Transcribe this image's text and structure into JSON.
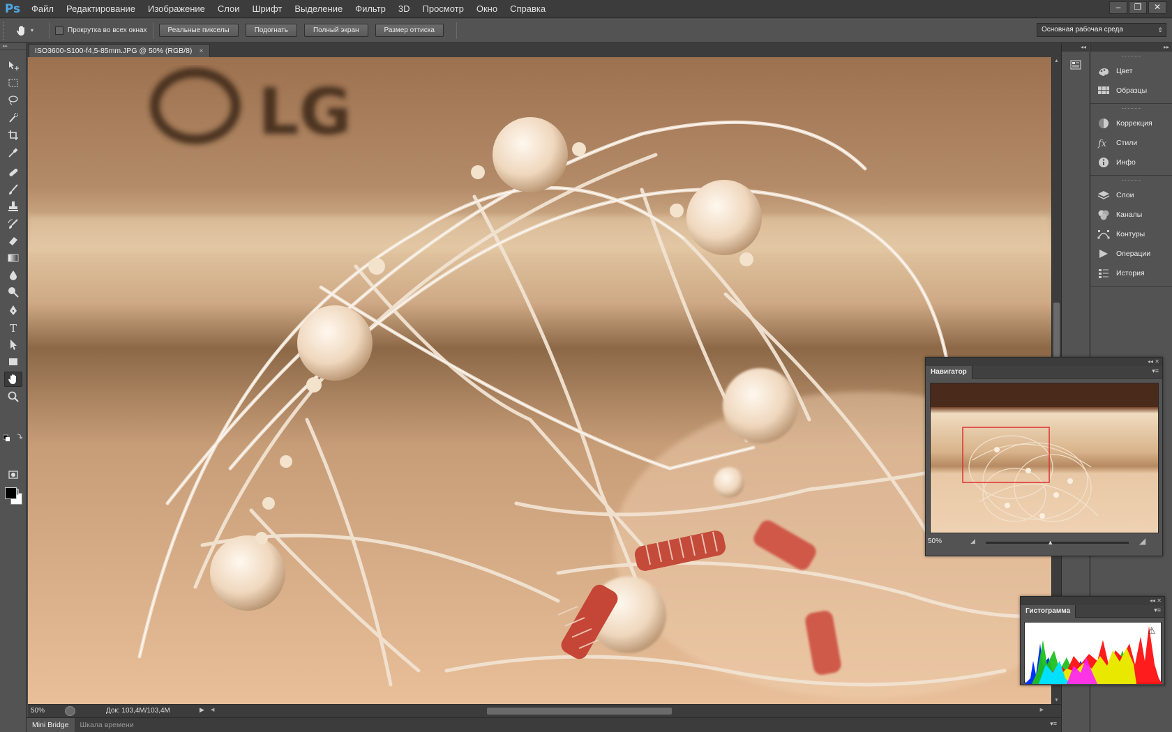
{
  "app": {
    "logo": "Ps"
  },
  "menu": [
    "Файл",
    "Редактирование",
    "Изображение",
    "Слои",
    "Шрифт",
    "Выделение",
    "Фильтр",
    "3D",
    "Просмотр",
    "Окно",
    "Справка"
  ],
  "window_buttons": {
    "minimize": "–",
    "restore": "❐",
    "close": "✕"
  },
  "options": {
    "scroll_all_label": "Прокрутка во всех окнах",
    "scroll_all_checked": false,
    "buttons": [
      "Реальные пикселы",
      "Подогнать",
      "Полный экран",
      "Размер оттиска"
    ],
    "workspace": "Основная рабочая среда"
  },
  "document": {
    "tab_title": "ISO3600-S100-f4,5-85mm.JPG @ 50% (RGB/8)",
    "tab_close": "×",
    "canvas_logo_text": "LG",
    "zoom": "50%",
    "doc_info": "Док: 103,4M/103,4M"
  },
  "bottom_tabs": [
    "Mini Bridge",
    "Шкала времени"
  ],
  "panels": {
    "col1_collapse": "◂◂",
    "col2_collapse": "▸▸",
    "groups": [
      [
        {
          "label": "Цвет",
          "icon": "color-icon"
        },
        {
          "label": "Образцы",
          "icon": "swatches-icon"
        }
      ],
      [
        {
          "label": "Коррекция",
          "icon": "adjustments-icon"
        },
        {
          "label": "Стили",
          "icon": "styles-icon"
        },
        {
          "label": "Инфо",
          "icon": "info-icon"
        }
      ],
      [
        {
          "label": "Слои",
          "icon": "layers-icon"
        },
        {
          "label": "Каналы",
          "icon": "channels-icon"
        },
        {
          "label": "Контуры",
          "icon": "paths-icon"
        },
        {
          "label": "Операции",
          "icon": "actions-icon"
        },
        {
          "label": "История",
          "icon": "history-icon"
        }
      ]
    ]
  },
  "navigator": {
    "title": "Навигатор",
    "zoom": "50%",
    "controls": "◂◂ ✕",
    "zoom_slider_fraction": 0.45
  },
  "histogram": {
    "title": "Гистограмма",
    "controls": "◂◂ ✕",
    "warning": "⚠"
  },
  "colors": {
    "foreground": "#000000",
    "background": "#ffffff",
    "nav_frame": "#e03030",
    "accent": "#4fa6e0"
  }
}
